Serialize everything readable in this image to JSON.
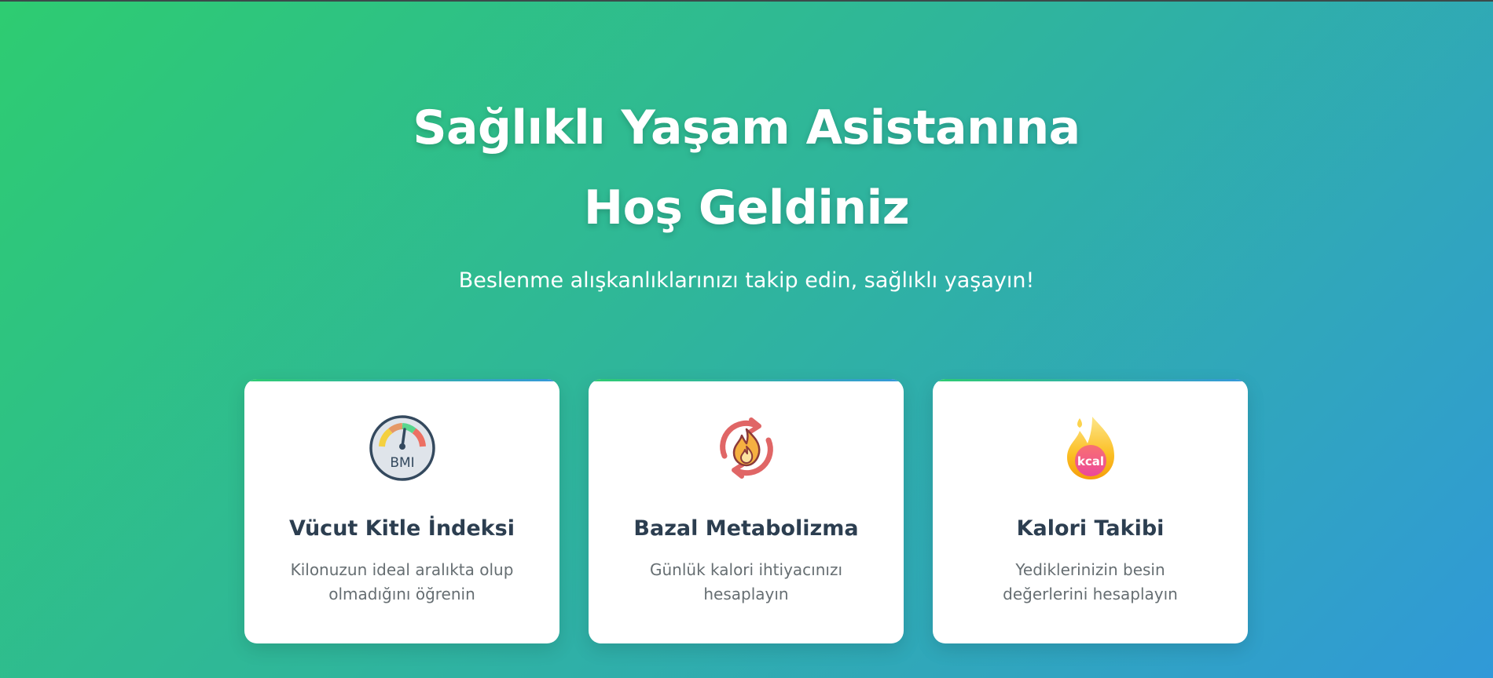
{
  "hero": {
    "title": "Sağlıklı Yaşam Asistanına Hoş Geldiniz",
    "subtitle": "Beslenme alışkanlıklarınızı takip edin, sağlıklı yaşayın!"
  },
  "cards": [
    {
      "icon": "bmi-gauge-icon",
      "icon_text": "BMI",
      "title": "Vücut Kitle İndeksi",
      "description": "Kilonuzun ideal aralıkta olup olmadığını öğrenin"
    },
    {
      "icon": "metabolism-fire-icon",
      "title": "Bazal Metabolizma",
      "description": "Günlük kalori ihtiyacınızı hesaplayın"
    },
    {
      "icon": "kcal-flame-icon",
      "icon_text": "kcal",
      "title": "Kalori Takibi",
      "description": "Yediklerinizin besin değerlerini hesaplayın"
    }
  ],
  "colors": {
    "gradient_start": "#2ecc71",
    "gradient_end": "#3099d8",
    "card_title": "#2c3e50",
    "card_text": "#666e72"
  }
}
